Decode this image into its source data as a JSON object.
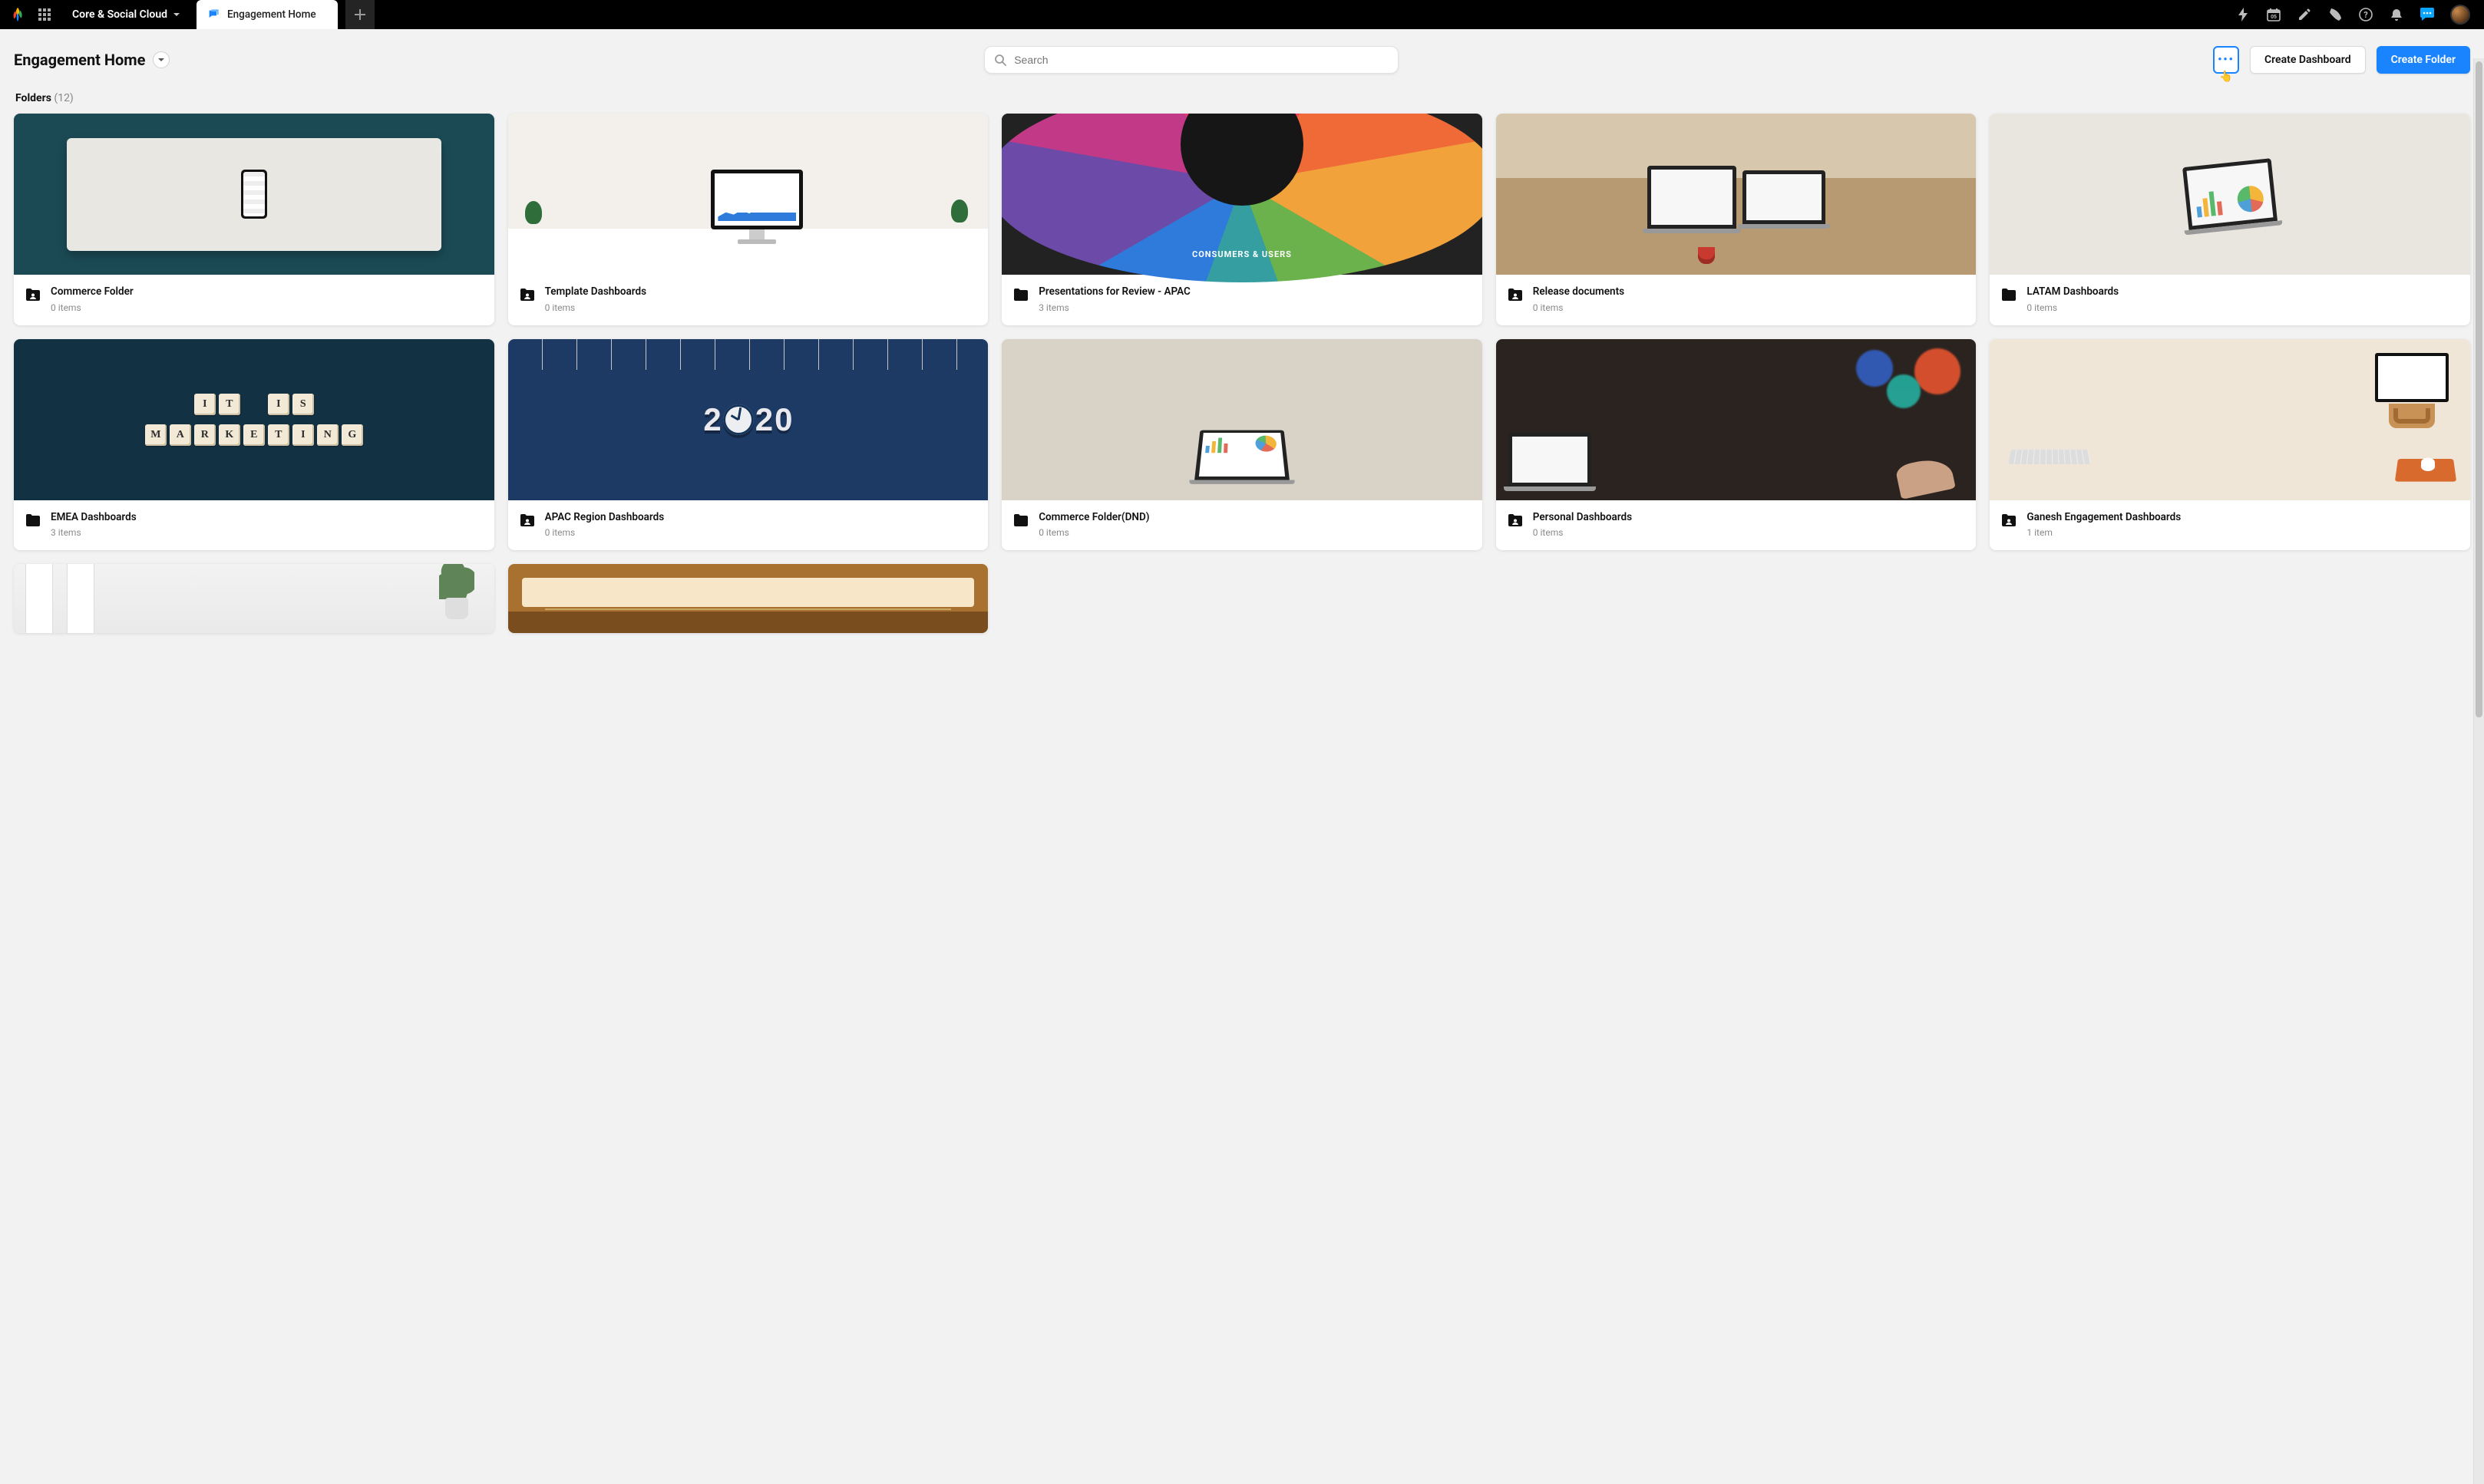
{
  "topbar": {
    "workspace": "Core & Social Cloud",
    "tab_label": "Engagement Home"
  },
  "header": {
    "title": "Engagement Home",
    "search_placeholder": "Search",
    "btn_dashboard": "Create Dashboard",
    "btn_folder": "Create Folder"
  },
  "section": {
    "label": "Folders",
    "count": "(12)"
  },
  "folders": [
    {
      "name": "Commerce Folder",
      "items": "0 items",
      "shared": true
    },
    {
      "name": "Template Dashboards",
      "items": "0 items",
      "shared": true
    },
    {
      "name": "Presentations for Review - APAC",
      "items": "3 items",
      "shared": false
    },
    {
      "name": "Release documents",
      "items": "0 items",
      "shared": true
    },
    {
      "name": "LATAM Dashboards",
      "items": "0 items",
      "shared": false
    },
    {
      "name": "EMEA Dashboards",
      "items": "3 items",
      "shared": false
    },
    {
      "name": "APAC Region Dashboards",
      "items": "0 items",
      "shared": true
    },
    {
      "name": "Commerce Folder(DND)",
      "items": "0 items",
      "shared": false
    },
    {
      "name": "Personal Dashboards",
      "items": "0 items",
      "shared": true
    },
    {
      "name": "Ganesh Engagement Dashboards",
      "items": "1 item",
      "shared": true
    },
    {
      "name": "",
      "items": "",
      "shared": false
    },
    {
      "name": "",
      "items": "",
      "shared": false
    }
  ],
  "thumb3_label": "CONSUMERS & USERS"
}
